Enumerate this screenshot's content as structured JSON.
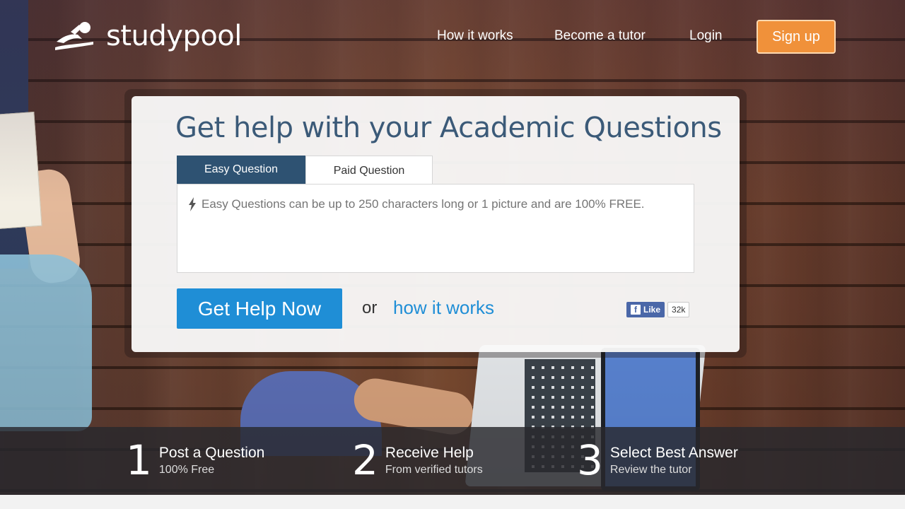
{
  "brand": {
    "name_part1": "study",
    "name_part2": "pool"
  },
  "nav": {
    "how_it_works": "How it works",
    "become_tutor": "Become a tutor",
    "login": "Login",
    "signup": "Sign up"
  },
  "card": {
    "headline": "Get help with your Academic Questions",
    "tabs": [
      {
        "label": "Easy Question",
        "active": true
      },
      {
        "label": "Paid Question",
        "active": false
      }
    ],
    "question_placeholder": "Easy Questions can be up to 250 characters long or 1 picture and are 100% FREE.",
    "cta_label": "Get Help Now",
    "or_text": "or",
    "how_link": "how it works",
    "fb_like": {
      "label": "Like",
      "count": "32k"
    }
  },
  "steps": [
    {
      "number": "1",
      "title": "Post a Question",
      "subtitle": "100% Free"
    },
    {
      "number": "2",
      "title": "Receive Help",
      "subtitle": "From verified tutors"
    },
    {
      "number": "3",
      "title": "Select Best Answer",
      "subtitle": "Review the tutor"
    }
  ],
  "colors": {
    "accent_orange": "#f0913a",
    "accent_blue": "#1f8ed6",
    "tab_dark": "#2e5272",
    "headline": "#3b5a78"
  },
  "icons": [
    "logo-swimmer-icon",
    "bolt-icon",
    "facebook-icon"
  ]
}
